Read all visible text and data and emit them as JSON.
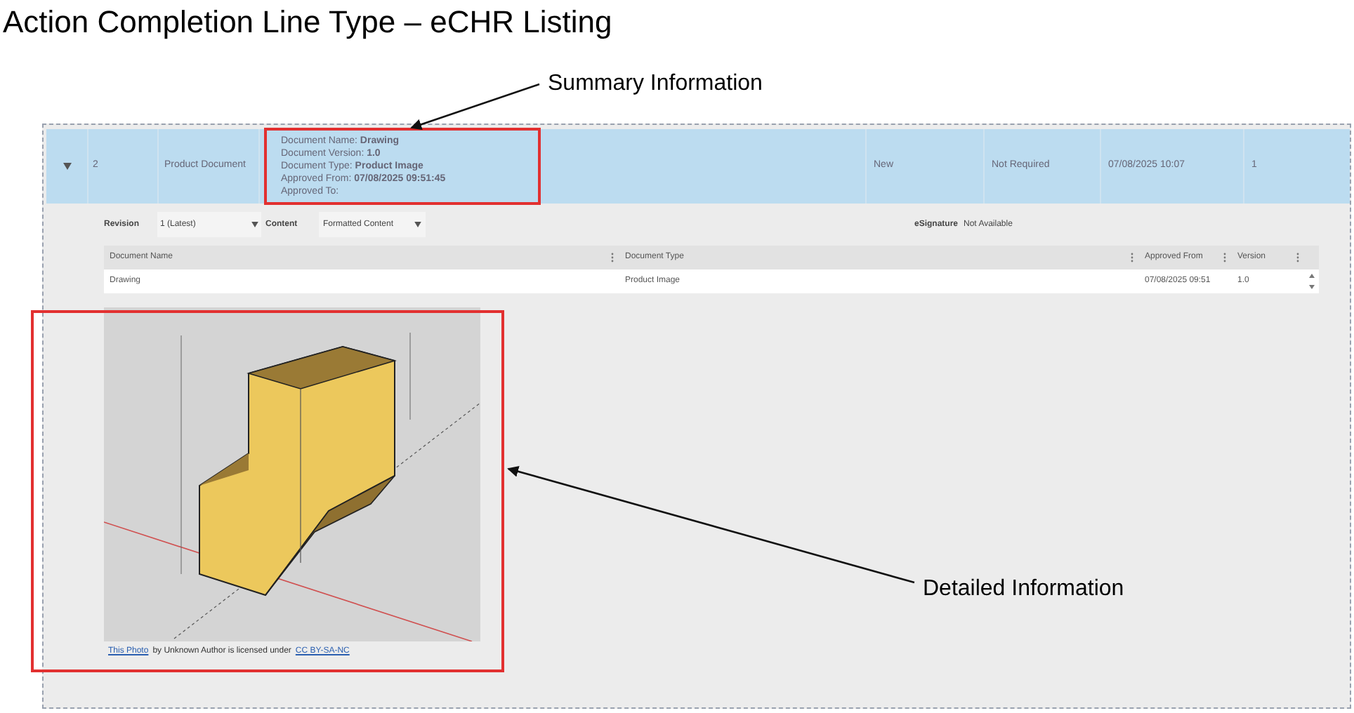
{
  "slide": {
    "title": "Action Completion Line Type – eCHR Listing"
  },
  "annotations": [
    {
      "text": "Summary Information"
    },
    {
      "text": "Detailed Information"
    }
  ],
  "listing_row": {
    "expanded": true,
    "number": "2",
    "type": "Product Document",
    "summary": [
      "Document Name: **Drawing**",
      "Document Version: **1.0**",
      "Document Type: **Product Image**",
      "Approved From: **07/08/2025 09:51:45**",
      "Approved To:"
    ],
    "status": "New",
    "esignature_status": "Not Required",
    "date": "07/08/2025 10:07",
    "column_8": "1"
  },
  "detail": {
    "revision": {
      "label": "Revision",
      "value": "1 (Latest)"
    },
    "content": {
      "label": "Content",
      "value": "Formatted Content"
    },
    "esignature": {
      "label": "eSignature",
      "value": "Not Available"
    },
    "table": {
      "columns": [
        "Document Name",
        "Document Type",
        "Approved From",
        "Version"
      ],
      "rows": [
        [
          "Drawing",
          "Product Image",
          "07/08/2025 09:51",
          "1.0"
        ]
      ]
    },
    "image_caption": {
      "link": "This Photo",
      "text": "by Unknown Author is licensed under",
      "license": "CC BY-SA-NC"
    }
  }
}
